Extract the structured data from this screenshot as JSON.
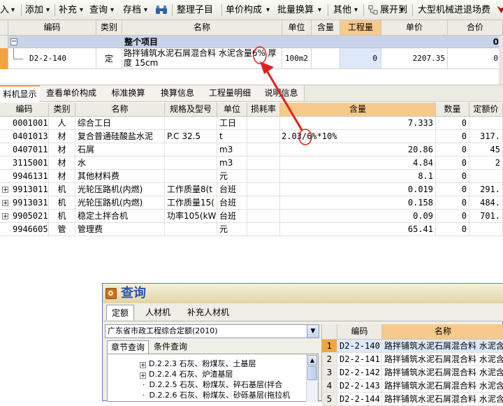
{
  "toolbar": {
    "items": [
      "入",
      "添加",
      "补充",
      "查询",
      "存档",
      "整理子目",
      "单价构成",
      "批量换算",
      "其他",
      "展开到",
      "大型机械进退场费"
    ]
  },
  "top_grid": {
    "headers": [
      "编码",
      "类别",
      "名称",
      "单位",
      "含量",
      "工程量",
      "单价",
      "合价"
    ],
    "group_row": {
      "toggle": "−",
      "name": "整个项目",
      "total": "0"
    },
    "item_row": {
      "code": "D2-2-140",
      "category": "定",
      "name_line1": "路拌铺筑水泥石屑混合料 水泥含量6% 厚",
      "name_line2": "度 15cm",
      "unit": "100m2",
      "quantity": "0",
      "price": "2207.35",
      "amount": "0"
    }
  },
  "tabs": [
    "料机显示",
    "查看单价构成",
    "标准换算",
    "换算信息",
    "工程量明细",
    "说明信息"
  ],
  "resource_grid": {
    "headers": [
      "编码",
      "类别",
      "名称",
      "规格及型号",
      "单位",
      "损耗率",
      "含量",
      "数量",
      "定额价"
    ],
    "rows": [
      {
        "code": "0001001",
        "cat": "人",
        "name": "综合工日",
        "spec": "",
        "unit": "工日",
        "content": "7.333",
        "qty": "0",
        "price": "",
        "plus": false
      },
      {
        "code": "0401013",
        "cat": "材",
        "name": "复合普通硅酸盐水泥",
        "spec": "P.C  32.5",
        "unit": "t",
        "content": "2.03/6%*10%",
        "qty": "0",
        "price": "317.",
        "plus": false
      },
      {
        "code": "0407011",
        "cat": "材",
        "name": "石屑",
        "spec": "",
        "unit": "m3",
        "content": "20.86",
        "qty": "0",
        "price": "45",
        "plus": false
      },
      {
        "code": "3115001",
        "cat": "材",
        "name": "水",
        "spec": "",
        "unit": "m3",
        "content": "4.84",
        "qty": "0",
        "price": "2",
        "plus": false
      },
      {
        "code": "9946131",
        "cat": "材",
        "name": "其他材料费",
        "spec": "",
        "unit": "元",
        "content": "8.1",
        "qty": "0",
        "price": "",
        "plus": false
      },
      {
        "code": "9913011",
        "cat": "机",
        "name": "光轮压路机(内燃)",
        "spec": "工作质量8(t",
        "unit": "台班",
        "content": "0.019",
        "qty": "0",
        "price": "291.",
        "plus": true
      },
      {
        "code": "9913031",
        "cat": "机",
        "name": "光轮压路机(内燃)",
        "spec": "工作质量15(",
        "unit": "台班",
        "content": "0.158",
        "qty": "0",
        "price": "484.",
        "plus": true
      },
      {
        "code": "9905021",
        "cat": "机",
        "name": "稳定土拌合机",
        "spec": "功率105(kW)",
        "unit": "台班",
        "content": "0.09",
        "qty": "0",
        "price": "701.",
        "plus": true
      },
      {
        "code": "9946605",
        "cat": "管",
        "name": "管理费",
        "spec": "",
        "unit": "元",
        "content": "65.41",
        "qty": "0",
        "price": "",
        "plus": false
      }
    ]
  },
  "query_window": {
    "title": "查询",
    "tabs": [
      "定额",
      "人材机",
      "补充人材机"
    ],
    "library": "广东省市政工程综合定额(2010)",
    "subtabs": [
      "章节查询",
      "条件查询"
    ],
    "tree": [
      "D.2.2.3 石灰、粉煤灰、土基层",
      "D.2.2.4 石灰、炉渣基层",
      "D.2.2.5 石灰、粉煤灰、碎石基层(拌合",
      "D.2.2.6 石灰、粉煤灰、砂砾基层(拖拉机"
    ],
    "result_headers": [
      "编码",
      "名称"
    ],
    "results": [
      {
        "idx": "1",
        "code": "D2-2-140",
        "name": "路拌铺筑水泥石屑混合料 水泥含"
      },
      {
        "idx": "2",
        "code": "D2-2-141",
        "name": "路拌铺筑水泥石屑混合料 水泥含"
      },
      {
        "idx": "3",
        "code": "D2-2-142",
        "name": "路拌铺筑水泥石屑混合料 水泥含"
      },
      {
        "idx": "4",
        "code": "D2-2-143",
        "name": "路拌铺筑水泥石屑混合料 水泥含"
      },
      {
        "idx": "5",
        "code": "D2-2-144",
        "name": "路拌铺筑水泥石屑混合料 水泥含"
      }
    ]
  },
  "colors": {
    "accent": "#f2a441",
    "highlight": "#dde9fb",
    "annotation": "#e02020",
    "title_blue": "#2a54b0"
  }
}
